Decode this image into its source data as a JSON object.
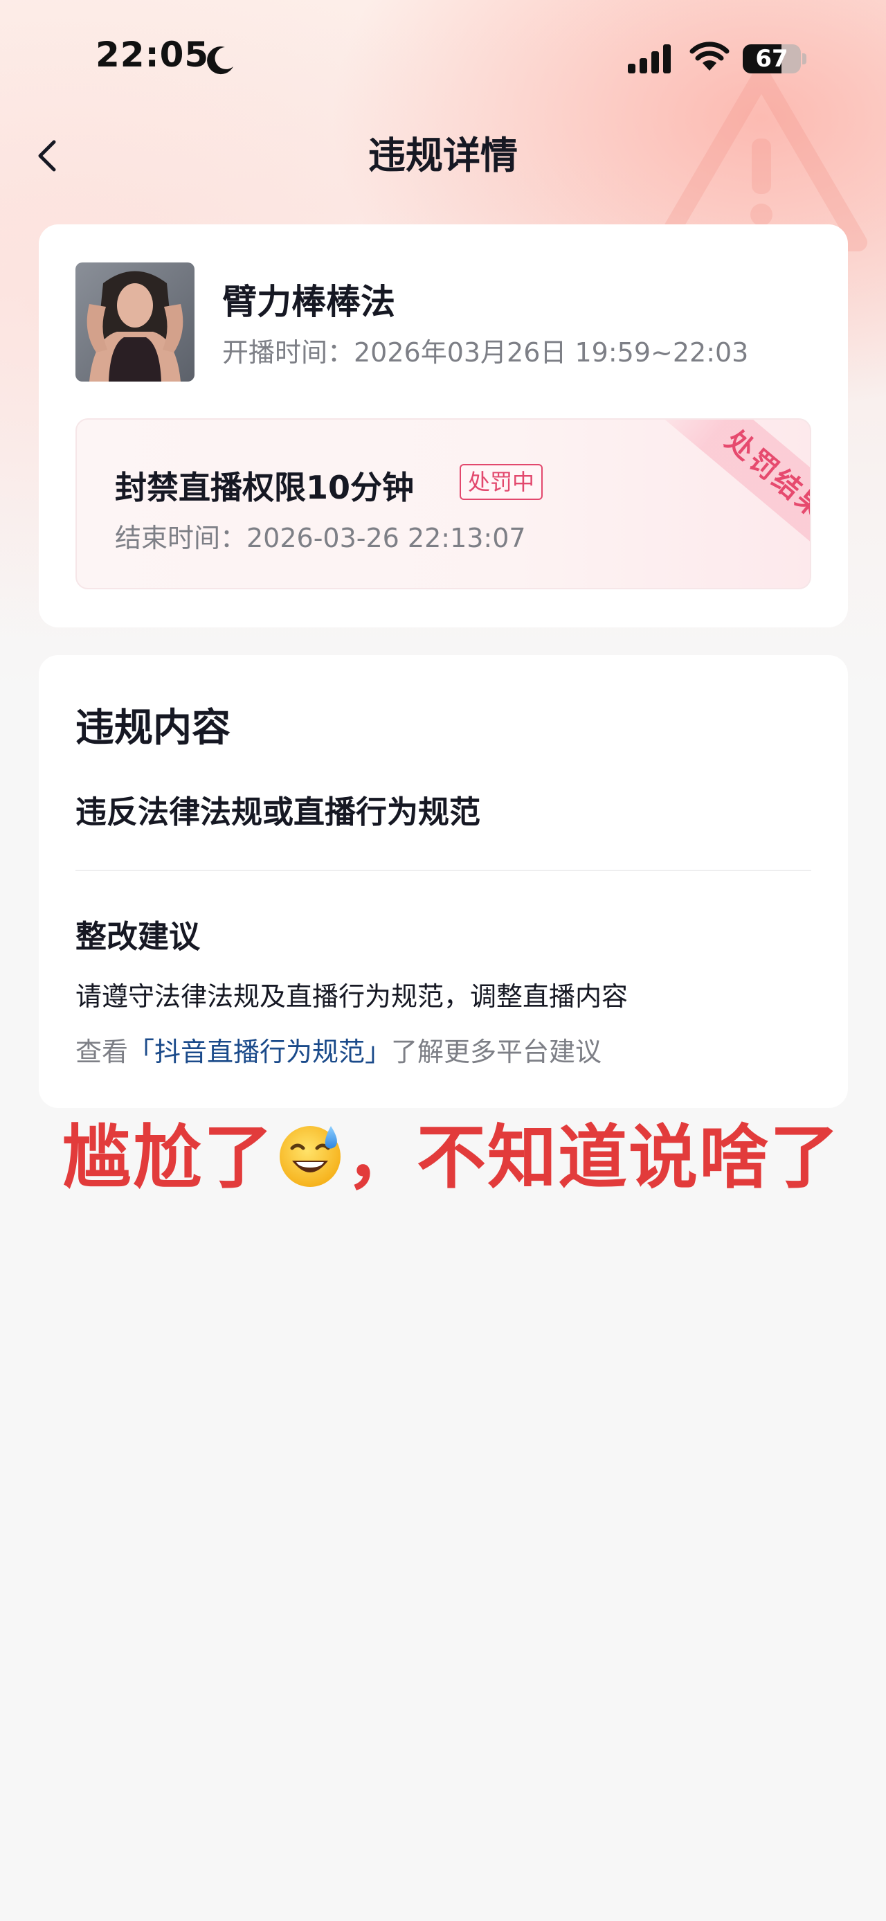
{
  "status_bar": {
    "time": "22:05",
    "battery": "67",
    "battery_level": 0.67
  },
  "nav": {
    "title": "违规详情"
  },
  "streamer": {
    "name": "臂力棒棒法",
    "stream_time": "开播时间：2026年03月26日 19:59~22:03"
  },
  "penalty": {
    "title": "封禁直播权限10分钟",
    "status": "处罚中",
    "end_time": "结束时间：2026-03-26 22:13:07",
    "ribbon": "处罚结果"
  },
  "violation": {
    "section_title": "违规内容",
    "reason": "违反法律法规或直播行为规范",
    "suggestion_title": "整改建议",
    "suggestion_text": "请遵守法律法规及直播行为规范，调整直播内容",
    "more_prefix": "查看",
    "guideline_link": "「抖音直播行为规范」",
    "more_suffix": "了解更多平台建议"
  },
  "caption": {
    "part1": "尴尬了",
    "emoji": "sweat-smile-emoji",
    "part2": "，不知道说啥了"
  },
  "colors": {
    "accent_red": "#e2486d",
    "caption_red": "#e23b3b",
    "link_blue": "#1a4a8a",
    "muted_text": "#7d7f86"
  }
}
